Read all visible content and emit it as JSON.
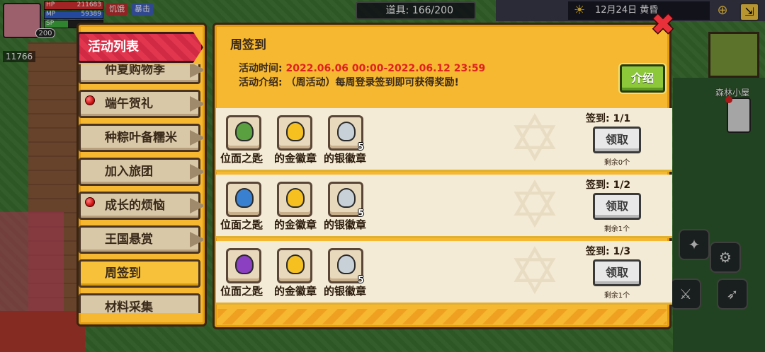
{
  "hud": {
    "level": "200",
    "hp_label": "HP",
    "hp_value": "211683",
    "mp_label": "MP",
    "mp_value": "59389",
    "sp_label": "SP",
    "tag_hungry": "饥饿",
    "tag_crit": "暴击",
    "coins": "11766",
    "items_label": "道具: 166/200",
    "date_label": "12月24日  黄昏",
    "location": "森林小屋"
  },
  "sidebar": {
    "title": "活动列表",
    "items": [
      {
        "label": "仲夏购物季",
        "dot": false,
        "active": false
      },
      {
        "label": "端午贺礼",
        "dot": true,
        "active": false
      },
      {
        "label": "种粽叶备糯米",
        "dot": false,
        "active": false
      },
      {
        "label": "加入旅团",
        "dot": false,
        "active": false
      },
      {
        "label": "成长的烦恼",
        "dot": true,
        "active": false
      },
      {
        "label": "王国悬赏",
        "dot": false,
        "active": false
      },
      {
        "label": "周签到",
        "dot": false,
        "active": true
      },
      {
        "label": "材料采集",
        "dot": false,
        "active": false
      }
    ]
  },
  "panel": {
    "title": "周签到",
    "time_label": "活动时间:",
    "time_value": "2022.06.06 00:00-2022.06.12 23:59",
    "intro_label": "活动介绍:",
    "intro_value": "（周活动）每周登录签到即可获得奖励!",
    "intro_button": "介绍",
    "close_icon": "close-icon",
    "rows": [
      {
        "items": [
          {
            "name": "位面之匙",
            "color": "#5aa040",
            "count": ""
          },
          {
            "name": "的金徽章",
            "color": "#f5c020",
            "count": ""
          },
          {
            "name": "的银徽章",
            "color": "#c8d0d8",
            "count": "5"
          }
        ],
        "sign": "签到: 1/1",
        "claim": "领取",
        "remain": "剩余0个"
      },
      {
        "items": [
          {
            "name": "位面之匙",
            "color": "#3a80d0",
            "count": ""
          },
          {
            "name": "的金徽章",
            "color": "#f5c020",
            "count": ""
          },
          {
            "name": "的银徽章",
            "color": "#c8d0d8",
            "count": "5"
          }
        ],
        "sign": "签到: 1/2",
        "claim": "领取",
        "remain": "剩余1个"
      },
      {
        "items": [
          {
            "name": "位面之匙",
            "color": "#8a40c0",
            "count": ""
          },
          {
            "name": "的金徽章",
            "color": "#f5c020",
            "count": ""
          },
          {
            "name": "的银徽章",
            "color": "#c8d0d8",
            "count": "5"
          }
        ],
        "sign": "签到: 1/3",
        "claim": "领取",
        "remain": "剩余1个"
      }
    ]
  }
}
